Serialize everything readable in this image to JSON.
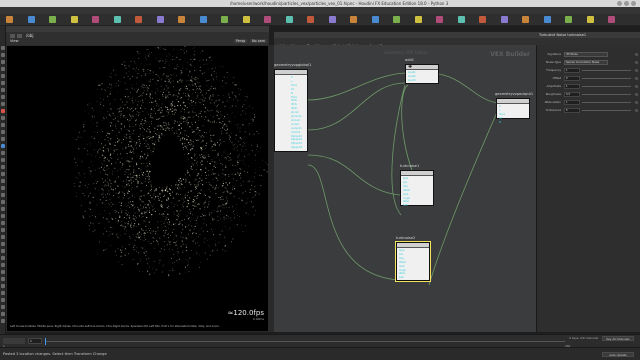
{
  "window": {
    "title": "/home/user/work/houdini/particles_vex/particles_vex_01.hipnc - Houdini FX Education Edition 18.0 - Python 3"
  },
  "menubar": {
    "items": [
      "File",
      "Edit",
      "Render",
      "Assets",
      "Windows",
      "Help",
      "Build",
      "Main"
    ]
  },
  "shelf_tabs": [
    "Create",
    "Modify",
    "Model",
    "Polygon",
    "Deform",
    "Texture",
    "Rigging",
    "Characters",
    "Guide Process",
    "Terrain FX",
    "Simple FX",
    "Cloud FX",
    "Volume",
    "Lights and Cameras",
    "Particles",
    "Grains",
    "Vellum",
    "Rigid Bodies",
    "Particle Fluids",
    "Viscous Fluids",
    "Oceans",
    "Fluid Containers",
    "Populate Containers",
    "Container Tools",
    "Pyro FX",
    "FEM",
    "Wires",
    "Crowds",
    "Drive Simulation"
  ],
  "viewport": {
    "tabs": [
      "Scene View",
      "Animation Editor",
      "Render View",
      "Composite View",
      "Motion FX View"
    ],
    "path": "/obj",
    "persp": "Persp",
    "cam": "No cam",
    "fps": "≈120.0fps",
    "fps_sub": "0.00ms",
    "status": "Left mouse tumbles. Middle pans. Right dollies. Ctrl+Alt+Left box-zooms. Ctrl+Right zooms. Spacebar-Ctrl-Left tilts. Hold L for alternate tumble, dolly, and zoom."
  },
  "network": {
    "tabs": [
      "/obj/geo1/...",
      "Tree View",
      "Material Palette",
      "Asset Browser"
    ],
    "path_tabs": [
      "obj",
      "geo1",
      "attribvop1"
    ],
    "menu": [
      "Add",
      "Edit",
      "Go",
      "View",
      "Tools",
      "Layout",
      "Labs",
      "Help"
    ],
    "context_label": "VEX Builder",
    "faint_label": "Geometry VOP Global...",
    "nodes": [
      {
        "id": "geometryvopglobal1",
        "label": "geometryvopglobal1"
      },
      {
        "id": "add1",
        "label": "add1"
      },
      {
        "id": "geometryvopoutput1",
        "label": "geometryvopoutput1"
      },
      {
        "id": "turbnoise1",
        "label": "turbnoise1"
      },
      {
        "id": "turbnoise2",
        "label": "turbnoise2"
      }
    ],
    "global_outputs": [
      "P",
      "v",
      "force",
      "Cd",
      "N",
      "Time",
      "dPdx",
      "dPdy",
      "dPdz",
      "ptnum",
      "primnum",
      "vtxnum",
      "numpt",
      "numprim",
      "numvtx",
      "OpInput1",
      "OpInput2",
      "OpInput3",
      "OpInput4"
    ],
    "add_inputs": [
      "input1",
      "input2",
      "input3"
    ],
    "output_inputs": [
      "P",
      "v",
      "force",
      "Cd",
      "N"
    ],
    "turb_inputs": [
      "type",
      "pos",
      "freq",
      "offset",
      "amp",
      "rough",
      "atten",
      "turb"
    ]
  },
  "params": {
    "title": "Turbulent Noise  turbnoise1",
    "rows": [
      {
        "label": "Signature",
        "value": "3D Noise",
        "kind": "dropdown"
      },
      {
        "label": "Noise Type",
        "value": "Sparse Convolution Noise",
        "kind": "dropdown"
      },
      {
        "label": "Frequency",
        "value": "1",
        "kind": "field"
      },
      {
        "label": "Offset",
        "value": "0",
        "kind": "field"
      },
      {
        "label": "Amplitude",
        "value": "1",
        "kind": "field"
      },
      {
        "label": "Roughness",
        "value": "0.5",
        "kind": "field"
      },
      {
        "label": "Attenuation",
        "value": "1",
        "kind": "field"
      },
      {
        "label": "Turbulence",
        "value": "5",
        "kind": "field"
      }
    ]
  },
  "timeline": {
    "frame": "1",
    "start": "1",
    "end": "240",
    "keys_label": "0 keys, 0/0 channels",
    "key_all": "Key All Channels",
    "auto_update": "Auto Update"
  },
  "statusbar": {
    "message": "Pasted 3 location changes. Select then Transform Change"
  },
  "colors": {
    "wire": "#6f9a6a",
    "port": "#3bd0dc",
    "selected": "#f2e35a",
    "points": "#e9e4c8"
  }
}
